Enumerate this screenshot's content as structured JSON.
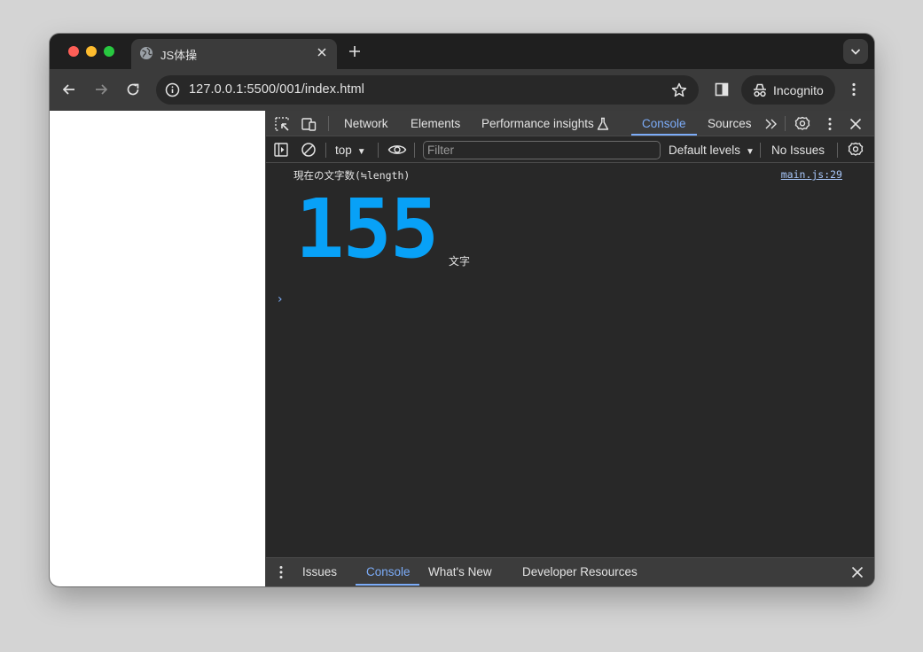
{
  "browser": {
    "tab": {
      "title": "JS体操",
      "favicon": "globe-icon"
    },
    "url": "127.0.0.1:5500/001/index.html",
    "incognito_label": "Incognito"
  },
  "devtools": {
    "tabs": [
      {
        "label": "Network"
      },
      {
        "label": "Elements"
      },
      {
        "label": "Performance insights"
      },
      {
        "label": "Console",
        "active": true
      },
      {
        "label": "Sources"
      }
    ],
    "console_toolbar": {
      "context": "top",
      "filter_placeholder": "Filter",
      "levels": "Default levels",
      "issues": "No Issues"
    },
    "log": {
      "message": "現在の文字数(≒length)",
      "source": "main.js:29",
      "count": "155",
      "unit": "文字",
      "count_color": "#08a1f7"
    },
    "prompt": "›",
    "drawer_tabs": [
      {
        "label": "Issues"
      },
      {
        "label": "Console",
        "active": true
      },
      {
        "label": "What's New"
      },
      {
        "label": "Developer Resources"
      }
    ]
  },
  "colors": {
    "accent": "#7cacf8",
    "toolbar_bg": "#3b3b3b",
    "console_bg": "#282828"
  }
}
